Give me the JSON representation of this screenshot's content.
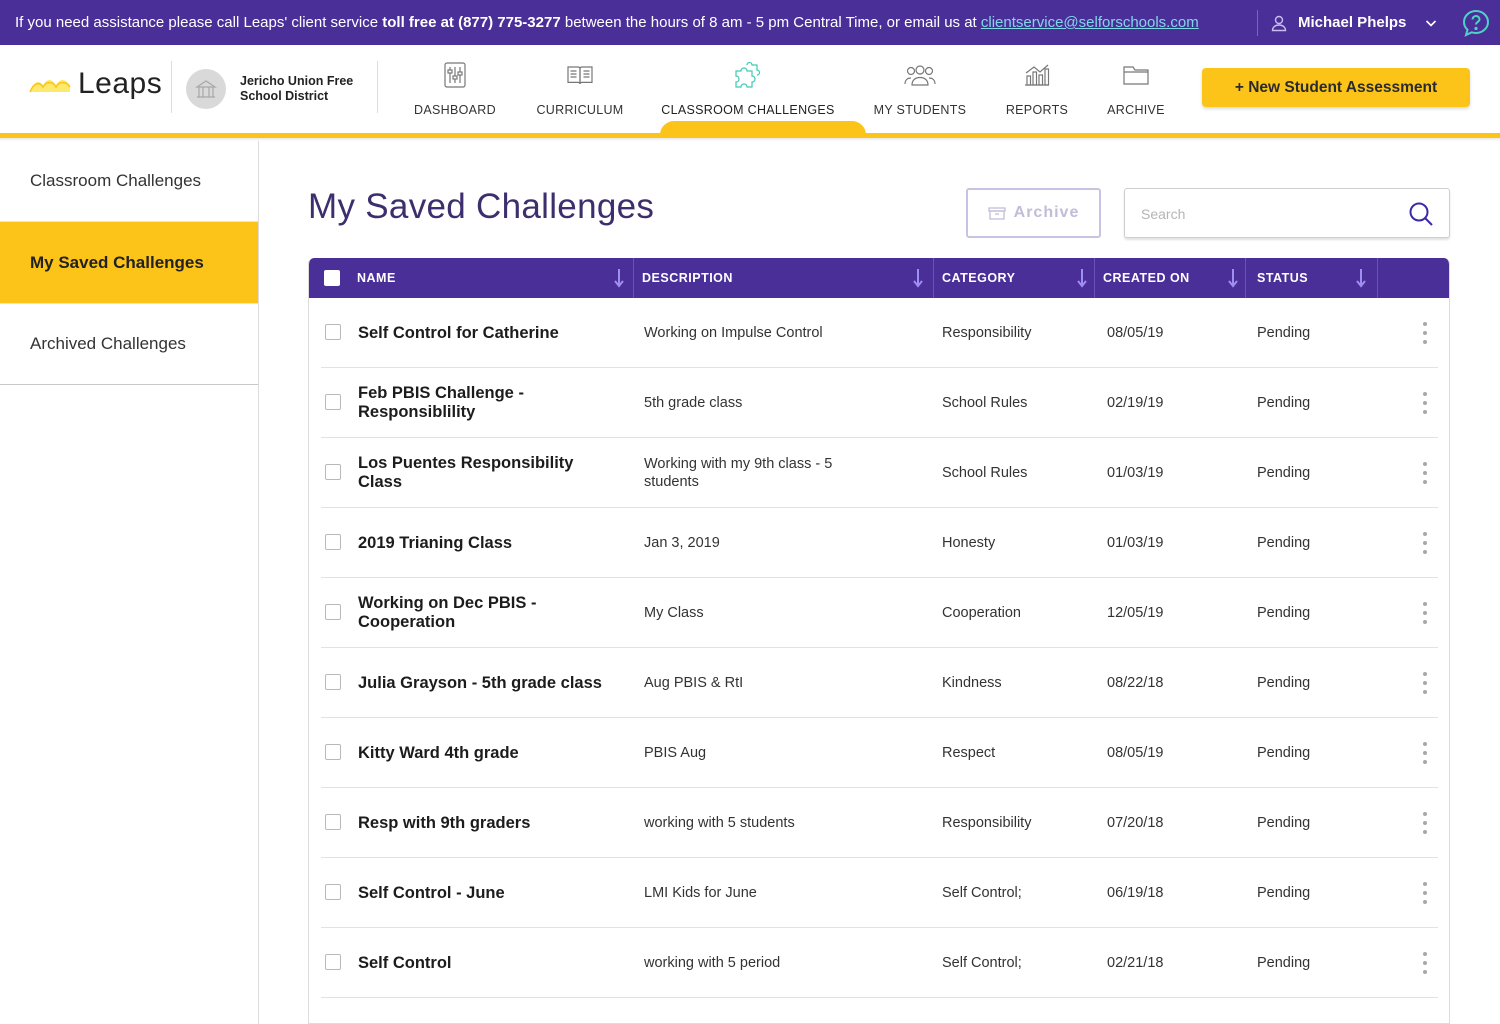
{
  "topbar": {
    "message_prefix": "If you need assistance please call Leaps' client service ",
    "message_bold": "toll free at (877) 775-3277",
    "message_mid": " between the hours of 8 am - 5 pm Central Time, or email us at ",
    "email": "clientservice@selforschools.com",
    "user_name": "Michael Phelps",
    "icons": [
      "user-icon",
      "chevron-down-icon",
      "help-icon"
    ]
  },
  "header": {
    "logo_text": "Leaps",
    "district_name": "Jericho Union Free School District",
    "nav": [
      {
        "label": "DASHBOARD",
        "icon": "dashboard-sliders-icon"
      },
      {
        "label": "CURRICULUM",
        "icon": "book-icon"
      },
      {
        "label": "CLASSROOM CHALLENGES",
        "icon": "puzzle-icon",
        "active": true
      },
      {
        "label": "MY STUDENTS",
        "icon": "students-icon"
      },
      {
        "label": "REPORTS",
        "icon": "chart-icon"
      },
      {
        "label": "ARCHIVE",
        "icon": "folder-icon"
      }
    ],
    "new_button": "+ New Student Assessment"
  },
  "sidebar": {
    "items": [
      {
        "label": "Classroom Challenges"
      },
      {
        "label": "My Saved Challenges",
        "active": true
      },
      {
        "label": "Archived Challenges"
      }
    ]
  },
  "main": {
    "title": "My Saved Challenges",
    "archive_button": "Archive",
    "search_placeholder": "Search",
    "columns": [
      "NAME",
      "DESCRIPTION",
      "CATEGORY",
      "CREATED ON",
      "STATUS"
    ],
    "rows": [
      {
        "name": "Self Control for Catherine",
        "description": "Working on Impulse Control",
        "category": "Responsibility",
        "created": "08/05/19",
        "status": "Pending"
      },
      {
        "name": "Feb PBIS Challenge - Responsiblility",
        "description": "5th grade class",
        "category": "School Rules",
        "created": "02/19/19",
        "status": "Pending"
      },
      {
        "name": "Los Puentes Responsibility Class",
        "description": "Working with my 9th class - 5 students",
        "category": "School Rules",
        "created": "01/03/19",
        "status": "Pending"
      },
      {
        "name": "2019 Trianing Class",
        "description": "Jan 3, 2019",
        "category": "Honesty",
        "created": "01/03/19",
        "status": "Pending"
      },
      {
        "name": "Working on Dec PBIS - Cooperation",
        "description": "My Class",
        "category": "Cooperation",
        "created": "12/05/19",
        "status": "Pending"
      },
      {
        "name": "Julia Grayson - 5th grade class",
        "description": "Aug PBIS & RtI",
        "category": "Kindness",
        "created": "08/22/18",
        "status": "Pending"
      },
      {
        "name": "Kitty Ward 4th grade",
        "description": "PBIS Aug",
        "category": "Respect",
        "created": "08/05/19",
        "status": "Pending"
      },
      {
        "name": "Resp with 9th graders",
        "description": "working with 5 students",
        "category": "Responsibility",
        "created": "07/20/18",
        "status": "Pending"
      },
      {
        "name": "Self Control - June",
        "description": "LMI Kids for June",
        "category": "Self Control;",
        "created": "06/19/18",
        "status": "Pending"
      },
      {
        "name": "Self Control",
        "description": "working with 5 period",
        "category": "Self Control;",
        "created": "02/21/18",
        "status": "Pending"
      }
    ]
  },
  "colors": {
    "brand_purple": "#4b2f99",
    "accent_yellow": "#fcc419",
    "title_purple": "#3d2f6e",
    "link_teal": "#7fd8e6"
  }
}
